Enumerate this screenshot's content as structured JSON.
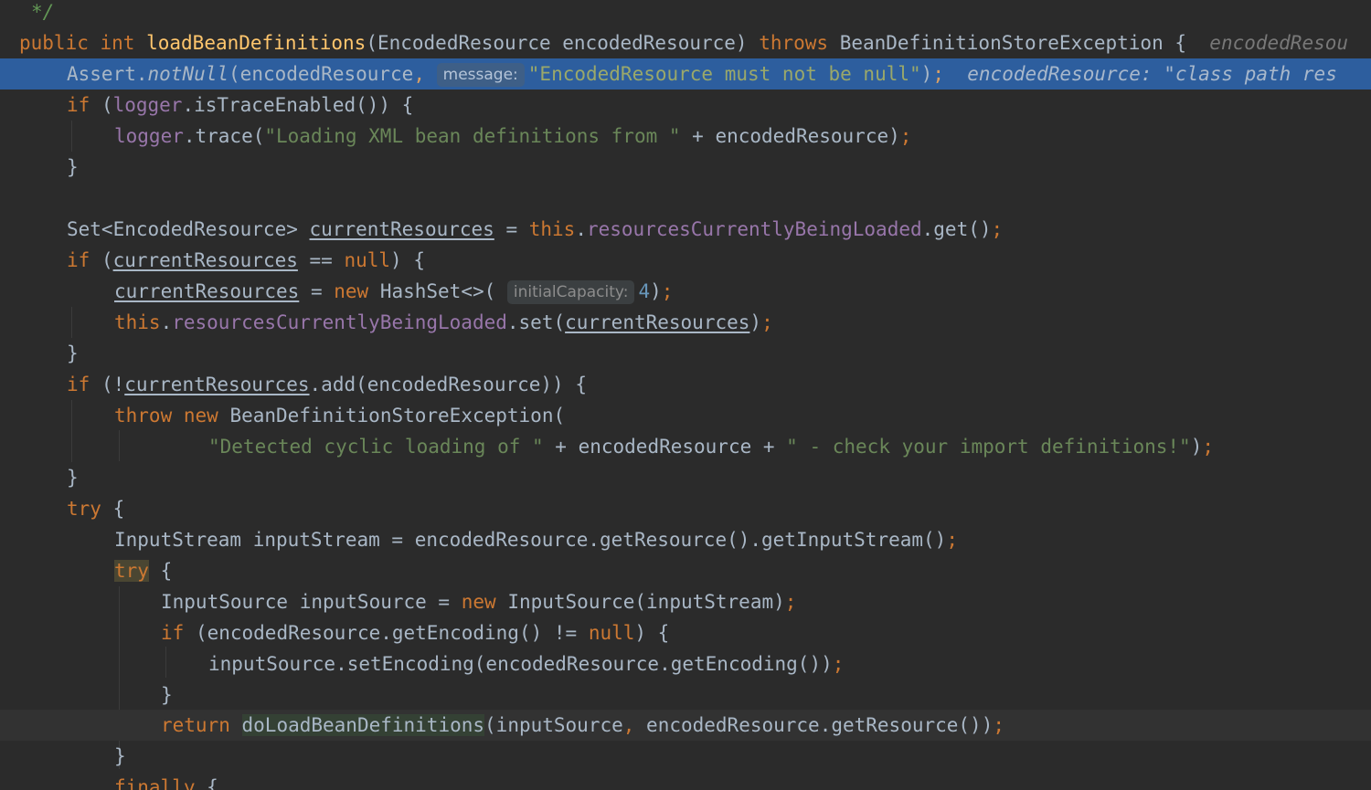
{
  "editor": {
    "lines": {
      "l0": {
        "comment": "*/"
      },
      "l1": {
        "kw_public": "public",
        "kw_int": "int",
        "method": "loadBeanDefinitions",
        "params": "(EncodedResource encodedResource) ",
        "kw_throws": "throws",
        "exception": " BeanDefinitionStoreException {",
        "inlay": "encodedResou"
      },
      "l2": {
        "assert": "Assert.",
        "notnull": "notNull",
        "arg": "(encodedResource",
        "comma": ",",
        "hint": "message:",
        "str": "\"EncodedResource must not be null\"",
        "close": ")",
        "semi": ";",
        "inlay": "encodedResource: \"class path res"
      },
      "l3": {
        "kw_if": "if",
        "p1": " (",
        "logger": "logger",
        "rest": ".isTraceEnabled()) {"
      },
      "l4": {
        "logger": "logger",
        "call": ".trace(",
        "str": "\"Loading XML bean definitions from \"",
        "rest": " + encodedResource)",
        "semi": ";"
      },
      "l5": {
        "brace": "}"
      },
      "l7": {
        "type": "Set<EncodedResource> ",
        "var": "currentResources",
        "eq": " = ",
        "kw_this": "this",
        "dot": ".",
        "field": "resourcesCurrentlyBeingLoaded",
        "rest": ".get()",
        "semi": ";"
      },
      "l8": {
        "kw_if": "if",
        "p1": " (",
        "var": "currentResources",
        "op": " == ",
        "kw_null": "null",
        "rest": ") {"
      },
      "l9": {
        "var": "currentResources",
        "eq": " = ",
        "kw_new": "new",
        "rest": " HashSet<>(",
        "hint": "initialCapacity:",
        "num": "4",
        "close": ")",
        "semi": ";"
      },
      "l10": {
        "kw_this": "this",
        "dot": ".",
        "field": "resourcesCurrentlyBeingLoaded",
        "call": ".set(",
        "var": "currentResources",
        "close": ")",
        "semi": ";"
      },
      "l11": {
        "brace": "}"
      },
      "l12": {
        "kw_if": "if",
        "p1": " (!",
        "var": "currentResources",
        "rest": ".add(encodedResource)) {"
      },
      "l13": {
        "kw_throw": "throw",
        "kw_new": "new",
        "rest": " BeanDefinitionStoreException("
      },
      "l14": {
        "str1": "\"Detected cyclic loading of \"",
        "mid": " + encodedResource + ",
        "str2": "\" - check your import definitions!\"",
        "close": ")",
        "semi": ";"
      },
      "l15": {
        "brace": "}"
      },
      "l16": {
        "kw_try": "try",
        "rest": " {"
      },
      "l17": {
        "text": "InputStream inputStream = encodedResource.getResource().getInputStream()",
        "semi": ";"
      },
      "l18": {
        "kw_try": "try",
        "rest": " {"
      },
      "l19": {
        "decl": "InputSource inputSource = ",
        "kw_new": "new",
        "rest": " InputSource(inputStream)",
        "semi": ";"
      },
      "l20": {
        "kw_if": "if",
        "rest": " (encodedResource.getEncoding() != ",
        "kw_null": "null",
        "close": ") {"
      },
      "l21": {
        "text": "inputSource.setEncoding(encodedResource.getEncoding())",
        "semi": ";"
      },
      "l22": {
        "brace": "}"
      },
      "l23": {
        "kw_return": "return",
        "call": "doLoadBeanDefinitions",
        "arg1": "(inputSource",
        "comma": ",",
        "rest": " encodedResource.getResource())",
        "semi": ";"
      },
      "l24": {
        "brace": "}"
      },
      "l25": {
        "kw_finally": "finally",
        "rest": " {"
      }
    }
  }
}
